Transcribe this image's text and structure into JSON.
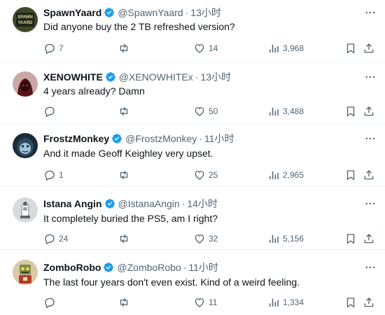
{
  "colors": {
    "verified": "#1d9bf0",
    "icon": "#536471",
    "text": "#0f1419",
    "divider": "#eff3f4"
  },
  "tweets": [
    {
      "name": "SpawnYaard",
      "handle": "@SpawnYaard",
      "time": "13小时",
      "text": "Did anyone buy the 2 TB refreshed version?",
      "replies": "7",
      "retweets": "",
      "likes": "14",
      "views": "3,968",
      "avatar_text": "SPAWN YAARD"
    },
    {
      "name": "XENOWHITE",
      "handle": "@XENOWHITEx",
      "time": "13小时",
      "text": "4 years already? Damn",
      "replies": "",
      "retweets": "",
      "likes": "50",
      "views": "3,488"
    },
    {
      "name": "FrostzMonkey",
      "handle": "@FrostzMonkey",
      "time": "11小时",
      "text": "And it made Geoff Keighley very upset.",
      "replies": "1",
      "retweets": "",
      "likes": "25",
      "views": "2,965"
    },
    {
      "name": "Istana Angin",
      "handle": "@IstanaAngin",
      "time": "14小时",
      "text": "It completely buried the PS5, am I right?",
      "replies": "24",
      "retweets": "",
      "likes": "32",
      "views": "5,156"
    },
    {
      "name": "ZomboRobo",
      "handle": "@ZomboRobo",
      "time": "11小时",
      "text": "The last four years don't even exist. Kind of a weird feeling.",
      "replies": "",
      "retweets": "",
      "likes": "11",
      "views": "1,334"
    }
  ],
  "icons": {
    "verified": "verified-badge-icon",
    "more": "more-options-icon",
    "reply": "reply-icon",
    "retweet": "retweet-icon",
    "like": "heart-icon",
    "views": "views-chart-icon",
    "bookmark": "bookmark-icon",
    "share": "share-icon"
  }
}
